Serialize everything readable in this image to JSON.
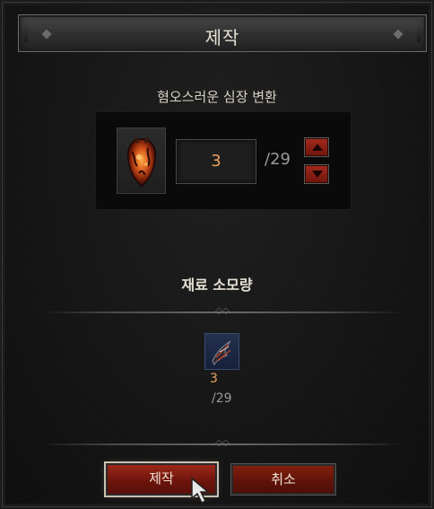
{
  "window": {
    "title": "제작"
  },
  "recipe": {
    "name": "혐오스러운 심장 변환",
    "quantity": "3",
    "max_quantity": "/29"
  },
  "materials": {
    "header": "재료 소모량",
    "items": [
      {
        "count": "3",
        "required": "/29",
        "icon": "material-claw-icon"
      }
    ]
  },
  "buttons": {
    "craft_label": "제작",
    "cancel_label": "취소"
  },
  "colors": {
    "accent_red": "#8a1c12",
    "quantity_orange": "#e8a25a",
    "material_slot_blue": "#1d2a45"
  }
}
